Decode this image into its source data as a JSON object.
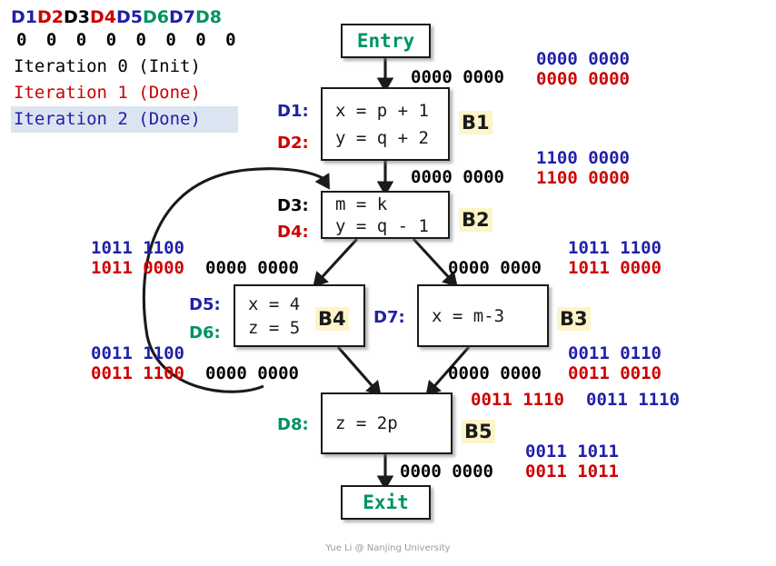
{
  "colors": {
    "blue": "#2020a8",
    "red": "#cc0000",
    "black": "#000000",
    "green": "#009460",
    "badge_bg": "#fdf5c9",
    "highlight_bg": "#dbe5f1",
    "edge": "#1a1a1a"
  },
  "legend": {
    "definition_labels": [
      {
        "text": "D1",
        "color": "#2020a8"
      },
      {
        "text": "D2",
        "color": "#cc0000"
      },
      {
        "text": "D3",
        "color": "#000000"
      },
      {
        "text": "D4",
        "color": "#cc0000"
      },
      {
        "text": "D5",
        "color": "#2020a8"
      },
      {
        "text": "D6",
        "color": "#009460"
      },
      {
        "text": "D7",
        "color": "#2020a8"
      },
      {
        "text": "D8",
        "color": "#009460"
      }
    ],
    "bit_row": "0 0 0 0 0 0 0 0",
    "iterations": [
      {
        "label": "Iteration 0 (Init)",
        "color": "#000000",
        "highlighted": false
      },
      {
        "label": "Iteration 1 (Done)",
        "color": "#cc0000",
        "highlighted": false
      },
      {
        "label": "Iteration 2 (Done)",
        "color": "#2020a8",
        "highlighted": true
      }
    ]
  },
  "nodes": {
    "entry": {
      "label": "Entry"
    },
    "exit": {
      "label": "Exit"
    },
    "b1": {
      "name": "B1",
      "statements": [
        {
          "tag": "D1:",
          "tag_color": "#2020a8",
          "code": "x = p + 1"
        },
        {
          "tag": "D2:",
          "tag_color": "#cc0000",
          "code": "y = q + 2"
        }
      ]
    },
    "b2": {
      "name": "B2",
      "statements": [
        {
          "tag": "D3:",
          "tag_color": "#000000",
          "code": "m = k"
        },
        {
          "tag": "D4:",
          "tag_color": "#cc0000",
          "code": "y = q - 1"
        }
      ]
    },
    "b4": {
      "name": "B4",
      "statements": [
        {
          "tag": "D5:",
          "tag_color": "#2020a8",
          "code": "x = 4"
        },
        {
          "tag": "D6:",
          "tag_color": "#009460",
          "code": "z = 5"
        }
      ]
    },
    "b3": {
      "name": "B3",
      "statements": [
        {
          "tag": "D7:",
          "tag_color": "#2020a8",
          "code": "x = m-3"
        }
      ]
    },
    "b5": {
      "name": "B5",
      "statements": [
        {
          "tag": "D8:",
          "tag_color": "#009460",
          "code": "z = 2p"
        }
      ]
    }
  },
  "facts": {
    "entry_out_black": "0000 0000",
    "entry_out_blue": "0000 0000",
    "entry_out_red": "0000 0000",
    "b1_out_black": "0000 0000",
    "b1_out_blue": "1100 0000",
    "b1_out_red": "1100 0000",
    "b2_left_blue": "1011 1100",
    "b2_left_red": "1011 0000",
    "b2_left_black": "0000 0000",
    "b2_right_black": "0000 0000",
    "b2_right_blue": "1011 1100",
    "b2_right_red": "1011 0000",
    "b4_left_blue": "0011 1100",
    "b4_left_red": "0011 1100",
    "b4_left_black": "0000 0000",
    "b3_out_black": "0000 0000",
    "b3_out_blue": "0011 0110",
    "b3_out_red": "0011 0010",
    "b5_in_red": "0011 1110",
    "b5_in_blue": "0011 1110",
    "b5_out_black": "0000 0000",
    "b5_out_blue": "0011 1011",
    "b5_out_red": "0011 1011"
  },
  "footer": {
    "text": "Yue Li @ Nanjing University"
  }
}
